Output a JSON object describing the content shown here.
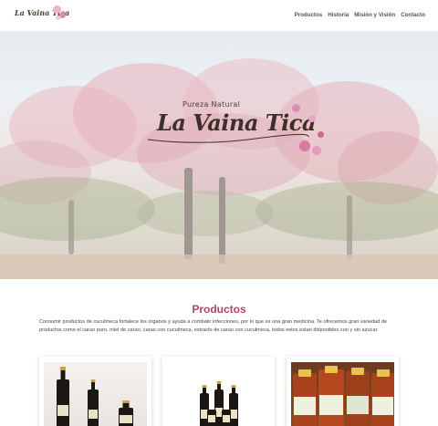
{
  "header": {
    "logo_text": "La Vaina Tica",
    "nav": [
      "Productos",
      "Historia",
      "Misión y Visión",
      "Contacto"
    ]
  },
  "hero": {
    "subtitle": "Pureza Natural",
    "title": "La Vaina Tica"
  },
  "products": {
    "title": "Productos",
    "description": "Consumir productos de cuculmeca fortalece los organos y ayuda a combatir infecciones, por lo que es una gran medicina. Te ofrecemos gran variedad de productos como el carao puro, miel de carao, carao con cuculmeca, extracto de carao con cuculmeca, todos estos estan disponibles con y sin azucar.",
    "cards": [
      "product-card-1",
      "product-card-2",
      "product-card-3"
    ]
  },
  "colors": {
    "accent": "#b0456e",
    "nav_text": "#555555",
    "hero_blossom": "#e4b2bc"
  }
}
